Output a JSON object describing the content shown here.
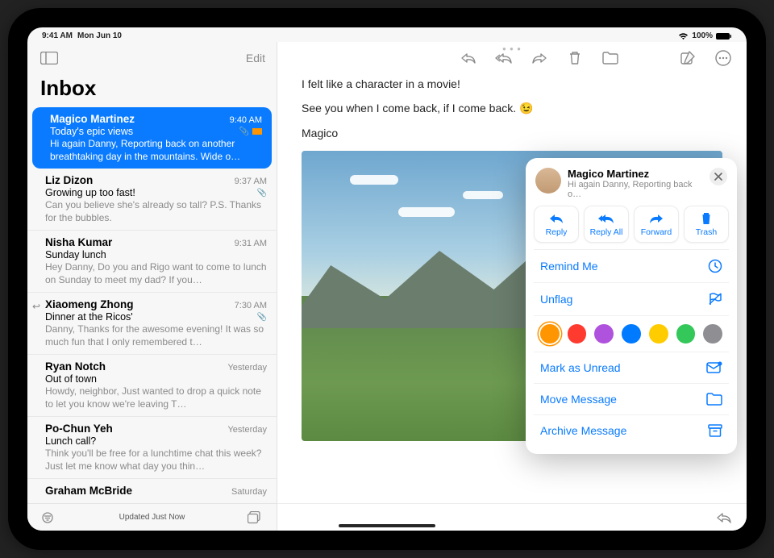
{
  "status": {
    "time": "9:41 AM",
    "date": "Mon Jun 10",
    "battery": "100%"
  },
  "sidebar": {
    "title": "Inbox",
    "edit": "Edit",
    "updated": "Updated Just Now",
    "items": [
      {
        "name": "Magico Martinez",
        "time": "9:40 AM",
        "subject": "Today's epic views",
        "preview": "Hi again Danny, Reporting back on another breathtaking day in the mountains. Wide o…",
        "selected": true,
        "flagged": true,
        "attachment": true
      },
      {
        "name": "Liz Dizon",
        "time": "9:37 AM",
        "subject": "Growing up too fast!",
        "preview": "Can you believe she's already so tall? P.S. Thanks for the bubbles.",
        "attachment": true
      },
      {
        "name": "Nisha Kumar",
        "time": "9:31 AM",
        "subject": "Sunday lunch",
        "preview": "Hey Danny, Do you and Rigo want to come to lunch on Sunday to meet my dad? If you…"
      },
      {
        "name": "Xiaomeng Zhong",
        "time": "7:30 AM",
        "subject": "Dinner at the Ricos'",
        "preview": "Danny, Thanks for the awesome evening! It was so much fun that I only remembered t…",
        "replied": true,
        "attachment": true
      },
      {
        "name": "Ryan Notch",
        "time": "Yesterday",
        "subject": "Out of town",
        "preview": "Howdy, neighbor, Just wanted to drop a quick note to let you know we're leaving T…"
      },
      {
        "name": "Po-Chun Yeh",
        "time": "Yesterday",
        "subject": "Lunch call?",
        "preview": "Think you'll be free for a lunchtime chat this week? Just let me know what day you thin…"
      },
      {
        "name": "Graham McBride",
        "time": "Saturday",
        "subject": "",
        "preview": ""
      }
    ]
  },
  "email": {
    "line1": "I felt like a character in a movie!",
    "line2_pre": "See you when I come back, if I come back. ",
    "line2_emoji": "😉",
    "signature": "Magico"
  },
  "popover": {
    "name": "Magico Martinez",
    "sub": "Hi again Danny, Reporting back o…",
    "actions": {
      "reply": "Reply",
      "reply_all": "Reply All",
      "forward": "Forward",
      "trash": "Trash"
    },
    "menu": {
      "remind": "Remind Me",
      "unflag": "Unflag",
      "mark_unread": "Mark as Unread",
      "move": "Move Message",
      "archive": "Archive Message"
    },
    "colors": [
      "#ff9500",
      "#ff3b30",
      "#af52de",
      "#007aff",
      "#ffcc00",
      "#34c759",
      "#8e8e93"
    ]
  }
}
